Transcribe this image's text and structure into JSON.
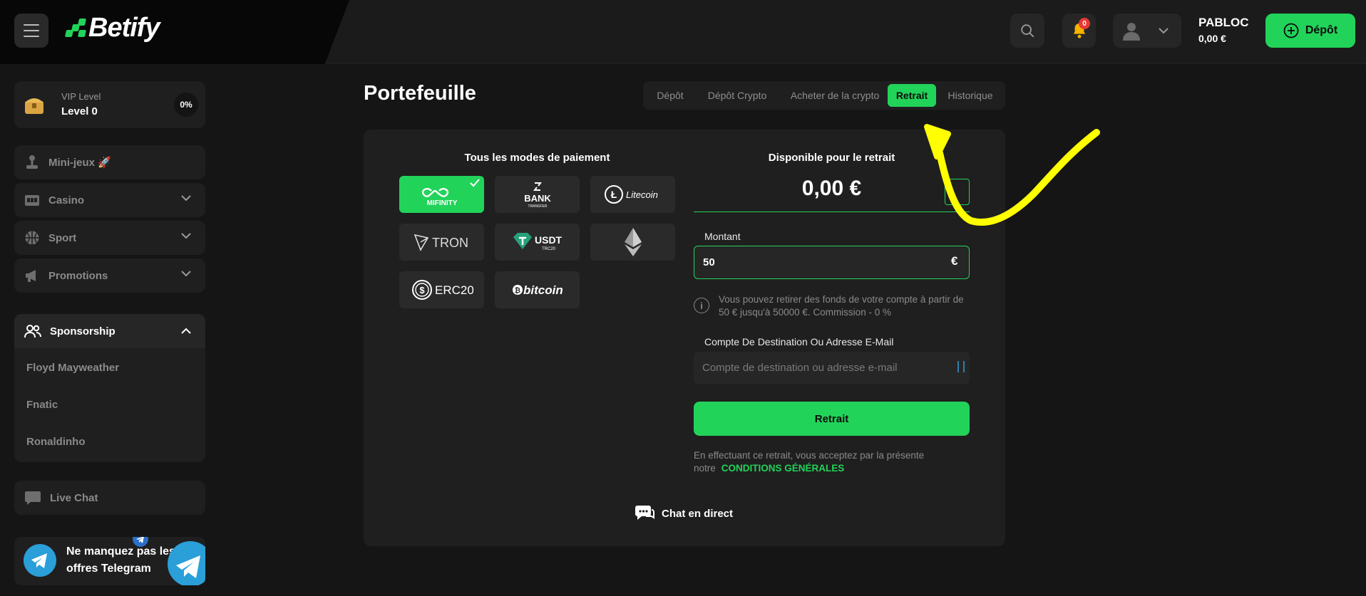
{
  "header": {
    "logo_text": "Betify",
    "notification_count": "0",
    "username": "PABLOC",
    "balance": "0,00 €",
    "depot_label": "Dépôt"
  },
  "sidebar": {
    "vip": {
      "label": "VIP Level",
      "level": "Level 0",
      "progress": "0%"
    },
    "items": [
      {
        "label": "Mini-jeux 🚀"
      },
      {
        "label": "Casino"
      },
      {
        "label": "Sport"
      },
      {
        "label": "Promotions"
      }
    ],
    "sponsorship": {
      "label": "Sponsorship",
      "links": [
        "Floyd Mayweather",
        "Fnatic",
        "Ronaldinho"
      ]
    },
    "live_chat": "Live Chat",
    "telegram": "Ne manquez pas les offres Telegram"
  },
  "main": {
    "title": "Portefeuille",
    "tabs": [
      {
        "label": "Dépôt",
        "active": false
      },
      {
        "label": "Dépôt Crypto",
        "active": false
      },
      {
        "label": "Acheter de la crypto",
        "active": false
      },
      {
        "label": "Retrait",
        "active": true
      },
      {
        "label": "Historique",
        "active": false
      }
    ],
    "payment_methods_title": "Tous les modes de paiement",
    "payment_methods": [
      {
        "name": "MIFINITY",
        "selected": true
      },
      {
        "name": "BANK TRANSFER",
        "selected": false
      },
      {
        "name": "Litecoin",
        "selected": false
      },
      {
        "name": "TRON",
        "selected": false
      },
      {
        "name": "USDT TRC20",
        "selected": false
      },
      {
        "name": "ethereum-icon",
        "selected": false
      },
      {
        "name": "ERC20",
        "selected": false
      },
      {
        "name": "bitcoin",
        "selected": false
      }
    ],
    "withdraw": {
      "available_title": "Disponible pour le retrait",
      "available_amount": "0,00 €",
      "amount_label": "Montant",
      "amount_value": "50",
      "currency": "€",
      "info": "Vous pouvez retirer des fonds de votre compte à partir de 50 € jusqu'à 50000 €. Commission - 0 %",
      "destination_label": "Compte De Destination Ou Adresse E-Mail",
      "destination_placeholder": "Compte de destination ou adresse e-mail",
      "button_label": "Retrait",
      "terms_text": "En effectuant ce retrait, vous acceptez par la présente notre",
      "terms_link": "CONDITIONS GÉNÉRALES"
    },
    "chat_label": "Chat en direct"
  },
  "colors": {
    "accent": "#22d35a",
    "background": "#151515",
    "panel": "#1f1f1f",
    "annotation": "#ffff00"
  }
}
